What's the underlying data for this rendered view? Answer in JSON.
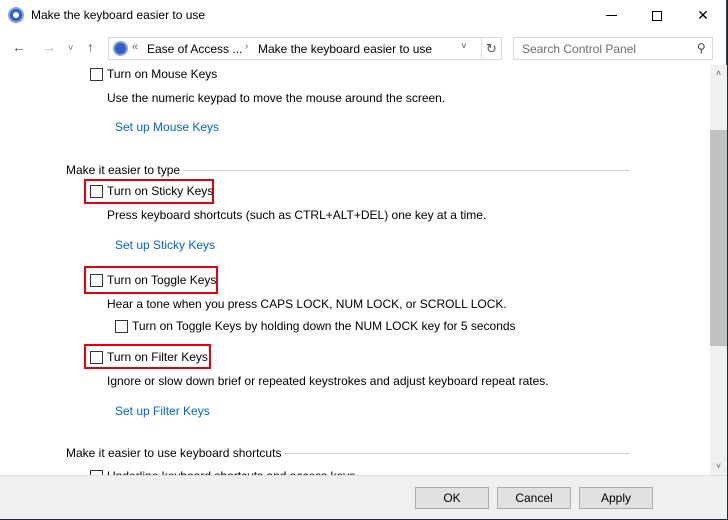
{
  "window": {
    "title": "Make the keyboard easier to use",
    "controls": {
      "minimize": "minimize-icon",
      "maximize": "maximize-icon",
      "close_glyph": "✕"
    }
  },
  "nav": {
    "back_glyph": "←",
    "forward_glyph": "→",
    "recent_glyph": "˅",
    "up_glyph": "↑",
    "address": {
      "chevron": "«",
      "crumbs": [
        "Ease of Access ...",
        "Make the keyboard easier to use"
      ],
      "separator": "›",
      "dropdown_glyph": "˅",
      "refresh_glyph": "↻"
    },
    "search": {
      "placeholder": "Search Control Panel",
      "value": "",
      "icon_glyph": "⚲"
    }
  },
  "content": {
    "mouse_keys": {
      "checkbox_label": "Turn on Mouse Keys",
      "checked": false,
      "description": "Use the numeric keypad to move the mouse around the screen.",
      "setup_link": "Set up Mouse Keys"
    },
    "section_type": {
      "title": "Make it easier to type",
      "sticky_keys": {
        "checkbox_label": "Turn on Sticky Keys",
        "checked": false,
        "highlighted": true,
        "description": "Press keyboard shortcuts (such as CTRL+ALT+DEL) one key at a time.",
        "setup_link": "Set up Sticky Keys"
      },
      "toggle_keys": {
        "checkbox_label": "Turn on Toggle Keys",
        "checked": false,
        "highlighted": true,
        "description": "Hear a tone when you press CAPS LOCK, NUM LOCK, or SCROLL LOCK.",
        "sub_checkbox_label": "Turn on Toggle Keys by holding down the NUM LOCK key for 5 seconds",
        "sub_checked": false
      },
      "filter_keys": {
        "checkbox_label": "Turn on Filter Keys",
        "checked": false,
        "highlighted": true,
        "description": "Ignore or slow down brief or repeated keystrokes and adjust keyboard repeat rates.",
        "setup_link": "Set up Filter Keys"
      }
    },
    "section_shortcuts": {
      "title": "Make it easier to use keyboard shortcuts",
      "underline": {
        "checkbox_label": "Underline keyboard shortcuts and access keys",
        "checked": false
      }
    }
  },
  "scrollbar": {
    "up_glyph": "˄",
    "down_glyph": "˅"
  },
  "footer": {
    "ok_label": "OK",
    "cancel_label": "Cancel",
    "apply_label": "Apply"
  },
  "colors": {
    "highlight_box": "#e3000f",
    "link": "#0066cc"
  }
}
